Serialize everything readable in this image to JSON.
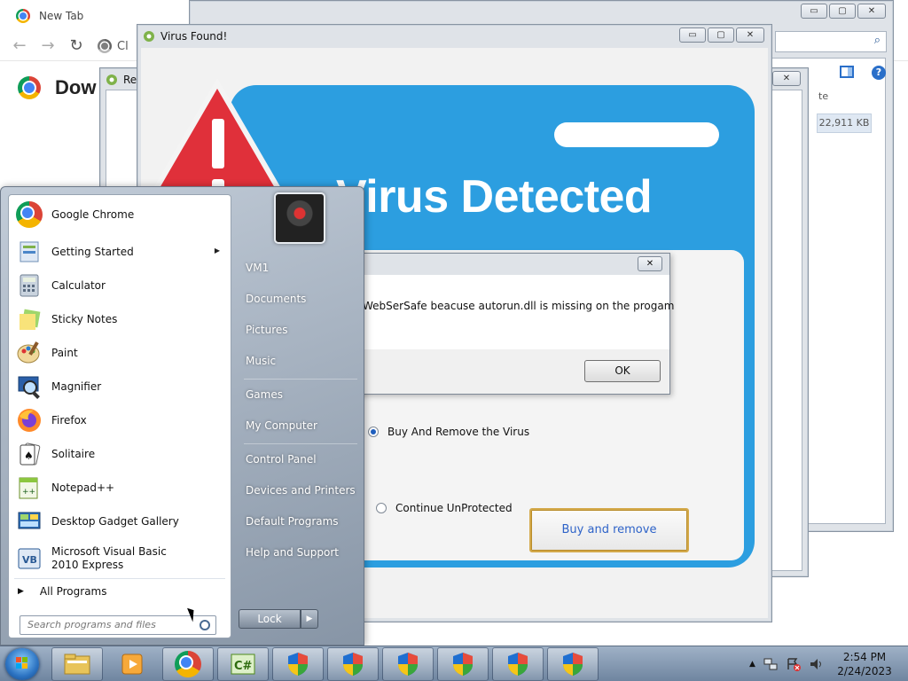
{
  "chrome": {
    "tab_title": "New Tab",
    "omnibox_text": "Cl",
    "page_heading": "Dow"
  },
  "explorer": {
    "column_header": "te",
    "file_size": "22,911 KB"
  },
  "re_window": {
    "title": "Re"
  },
  "virus_window": {
    "title": "Virus Found!",
    "headline": "Virus Detected",
    "option_buy": "Buy And Remove the Virus",
    "option_continue": "Continue UnProtected",
    "buy_button": "Buy and remove"
  },
  "dialog": {
    "message": "WebSerSafe beacuse autorun.dll is missing on the progam",
    "ok_label": "OK"
  },
  "window_controls": {
    "minimize": "▭",
    "maximize": "▢",
    "close": "✕"
  },
  "start_menu": {
    "pinned": [
      {
        "label": "Google Chrome",
        "icon": "chrome-icon"
      },
      {
        "label": "Getting Started",
        "icon": "getting-started-icon",
        "submenu": true
      },
      {
        "label": "Calculator",
        "icon": "calculator-icon"
      },
      {
        "label": "Sticky Notes",
        "icon": "sticky-notes-icon"
      },
      {
        "label": "Paint",
        "icon": "paint-icon"
      },
      {
        "label": "Magnifier",
        "icon": "magnifier-icon"
      },
      {
        "label": "Firefox",
        "icon": "firefox-icon"
      },
      {
        "label": "Solitaire",
        "icon": "solitaire-icon"
      },
      {
        "label": "Notepad++",
        "icon": "notepad-plus-plus-icon"
      },
      {
        "label": "Desktop Gadget Gallery",
        "icon": "gadget-gallery-icon"
      },
      {
        "label": "Microsoft Visual Basic 2010 Express",
        "icon": "visual-basic-icon"
      }
    ],
    "all_programs": "All Programs",
    "search_placeholder": "Search programs and files",
    "right_links": {
      "user": "VM1",
      "documents": "Documents",
      "pictures": "Pictures",
      "music": "Music",
      "games": "Games",
      "computer": "My Computer",
      "control_panel": "Control Panel",
      "devices": "Devices and Printers",
      "default_programs": "Default Programs",
      "help": "Help and Support"
    },
    "lock_label": "Lock",
    "lock_arrow": "▶"
  },
  "taskbar": {
    "time": "2:54 PM",
    "date": "2/24/2023"
  },
  "colors": {
    "panel_blue": "#2c9ee0",
    "warning_red": "#e0303a",
    "button_border": "#d3a94a"
  }
}
